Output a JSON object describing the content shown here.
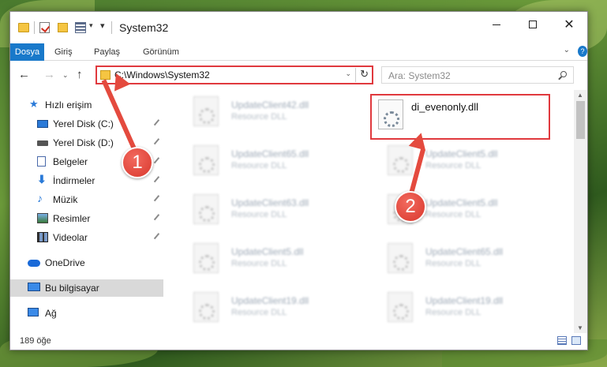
{
  "window": {
    "title": "System32",
    "minimize_glyph": "",
    "maximize_glyph": "",
    "close_glyph": "✕"
  },
  "quick_access_toolbar": {
    "dropdown_glyph": "▾",
    "customize_glyph": "▾"
  },
  "ribbon": {
    "tabs": [
      "Dosya",
      "Giriş",
      "Paylaş",
      "Görünüm"
    ],
    "expand_glyph": "⌄",
    "help_glyph": "?"
  },
  "navigation": {
    "back_glyph": "←",
    "forward_glyph": "→",
    "recent_glyph": "⌄",
    "up_glyph": "↑",
    "address": "C:\\Windows\\System32",
    "address_dropdown_glyph": "⌄",
    "refresh_glyph": "↻",
    "search_placeholder": "Ara: System32"
  },
  "sidebar": {
    "items": [
      {
        "label": "Hızlı erişim",
        "icon": "star-icon",
        "pinned": false
      },
      {
        "label": "Yerel Disk (C:)",
        "icon": "desktop-icon",
        "pinned": true
      },
      {
        "label": "Yerel Disk (D:)",
        "icon": "drive-icon",
        "pinned": true
      },
      {
        "label": "Belgeler",
        "icon": "document-icon",
        "pinned": true
      },
      {
        "label": "İndirmeler",
        "icon": "download-icon",
        "pinned": true
      },
      {
        "label": "Müzik",
        "icon": "music-icon",
        "pinned": true
      },
      {
        "label": "Resimler",
        "icon": "pictures-icon",
        "pinned": true
      },
      {
        "label": "Videolar",
        "icon": "video-icon",
        "pinned": true
      },
      {
        "label": "OneDrive",
        "icon": "cloud-icon",
        "pinned": false
      },
      {
        "label": "Bu bilgisayar",
        "icon": "computer-icon",
        "pinned": false,
        "selected": true
      },
      {
        "label": "Ağ",
        "icon": "network-icon",
        "pinned": false
      }
    ],
    "glyphs": {
      "star": "★",
      "download": "⬇",
      "music": "♪"
    }
  },
  "files": {
    "left_column": [
      {
        "name": "UpdateClient42.dll",
        "type": "Resource DLL"
      },
      {
        "name": "UpdateClient65.dll",
        "type": "Resource DLL"
      },
      {
        "name": "UpdateClient63.dll",
        "type": "Resource DLL"
      },
      {
        "name": "UpdateClient5.dll",
        "type": "Resource DLL"
      },
      {
        "name": "UpdateClient19.dll",
        "type": "Resource DLL"
      }
    ],
    "right_column": [
      {
        "name": "di_evenonly.dll",
        "type": "",
        "highlighted": true
      },
      {
        "name": "UpdateClient5.dll",
        "type": "Resource DLL"
      },
      {
        "name": "UpdateClient5.dll",
        "type": "Resource DLL"
      },
      {
        "name": "UpdateClient65.dll",
        "type": "Resource DLL"
      },
      {
        "name": "UpdateClient19.dll",
        "type": "Resource DLL"
      }
    ]
  },
  "scrollbar": {
    "up_glyph": "▲",
    "down_glyph": "▼"
  },
  "status": {
    "item_count": "189 öğe"
  },
  "callouts": [
    {
      "number": "1"
    },
    {
      "number": "2"
    }
  ],
  "colors": {
    "accent": "#1979ca",
    "highlight": "#e0393e",
    "callout": "#e44a3e"
  }
}
